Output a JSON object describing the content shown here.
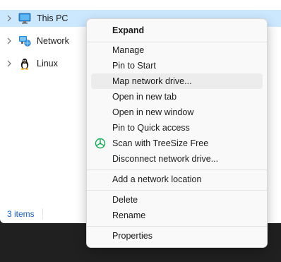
{
  "tree": {
    "items": [
      {
        "label": "This PC",
        "icon": "monitor-icon",
        "selected": true
      },
      {
        "label": "Network",
        "icon": "network-icon",
        "selected": false
      },
      {
        "label": "Linux",
        "icon": "linux-penguin-icon",
        "selected": false
      }
    ]
  },
  "status": {
    "items_count": "3 items"
  },
  "context_menu": {
    "items": [
      {
        "label": "Expand",
        "bold": true
      },
      {
        "label": "Manage"
      },
      {
        "label": "Pin to Start"
      },
      {
        "label": "Map network drive...",
        "highlighted": true
      },
      {
        "label": "Open in new tab"
      },
      {
        "label": "Open in new window"
      },
      {
        "label": "Pin to Quick access"
      },
      {
        "label": "Scan with TreeSize Free",
        "icon": "treesize-icon"
      },
      {
        "label": "Disconnect network drive..."
      },
      {
        "label": "Add a network location"
      },
      {
        "label": "Delete"
      },
      {
        "label": "Rename"
      },
      {
        "label": "Properties"
      }
    ]
  },
  "colors": {
    "selection": "#cce8ff",
    "menu_background": "#f9f9f9",
    "menu_hover": "#ececec",
    "taskbar": "#202020",
    "status_text": "#1a5fb4",
    "treesize_green": "#1aa85a"
  }
}
